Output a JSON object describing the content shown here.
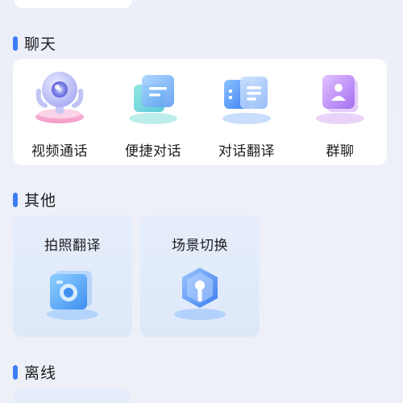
{
  "sections": {
    "chat": {
      "title": "聊天",
      "items": [
        {
          "label": "视频通话",
          "icon": "video-call-icon"
        },
        {
          "label": "便捷对话",
          "icon": "quick-chat-icon"
        },
        {
          "label": "对话翻译",
          "icon": "dialogue-translate-icon"
        },
        {
          "label": "群聊",
          "icon": "group-chat-icon"
        }
      ]
    },
    "other": {
      "title": "其他",
      "items": [
        {
          "label": "拍照翻译",
          "icon": "photo-translate-icon"
        },
        {
          "label": "场景切换",
          "icon": "scene-switch-icon"
        }
      ]
    },
    "offline": {
      "title": "离线"
    }
  },
  "colors": {
    "accent": "#3f7df6",
    "background": "#eceef8",
    "card": "#ffffff",
    "tile": "#e3ebfa"
  }
}
